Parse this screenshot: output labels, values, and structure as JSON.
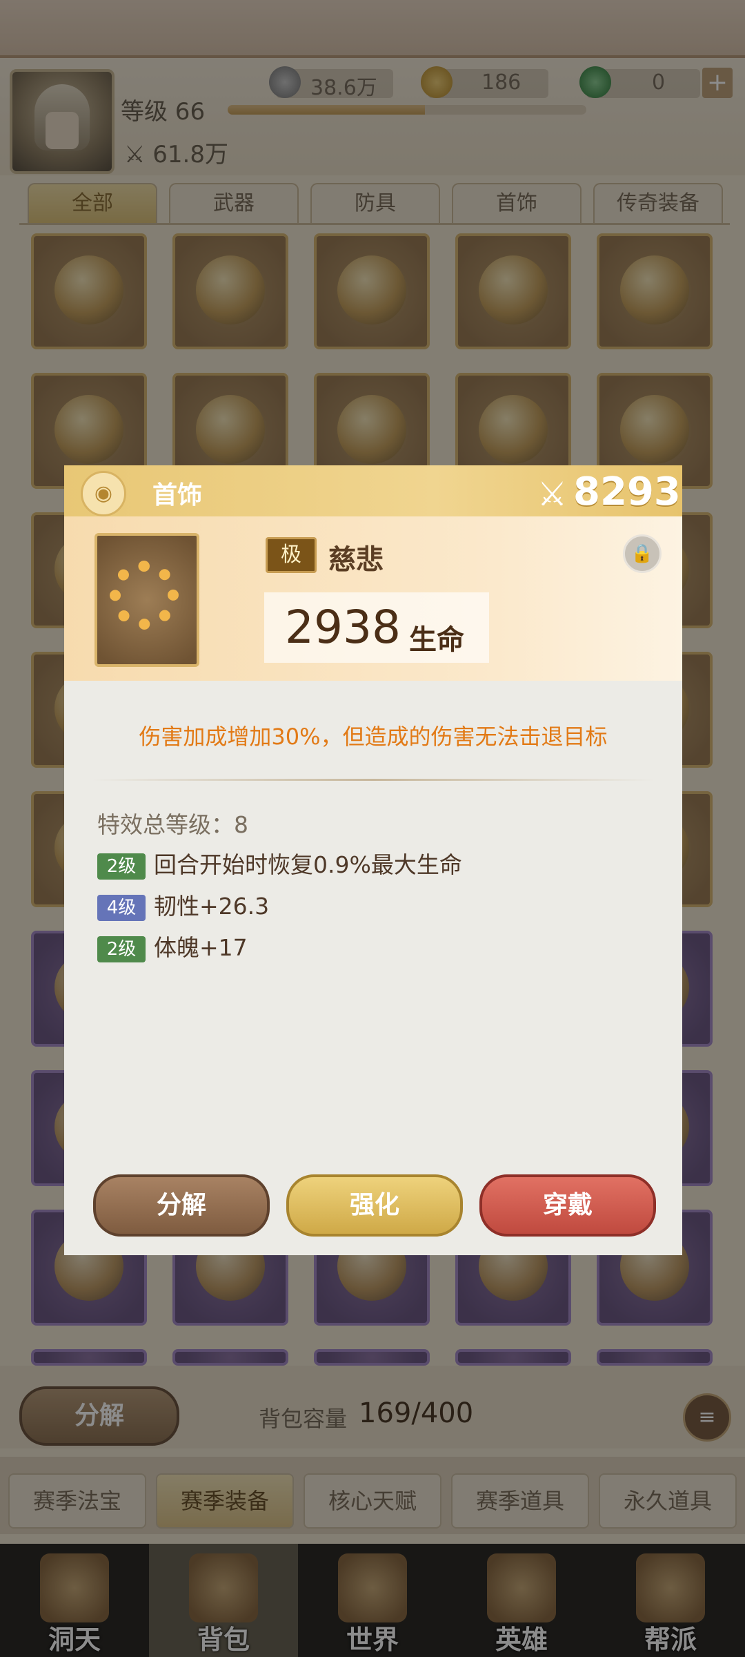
{
  "header": {
    "level_label": "等级 66",
    "level_progress": 0.55,
    "power": "61.8万",
    "resources": [
      {
        "icon": "silver-ingot-icon",
        "value": "38.6万"
      },
      {
        "icon": "gold-ingot-icon",
        "value": "186"
      },
      {
        "icon": "jade-toad-icon",
        "value": "0"
      }
    ],
    "plus": "+"
  },
  "category_tabs": [
    "全部",
    "武器",
    "防具",
    "首饰",
    "传奇装备"
  ],
  "dialog": {
    "category": "首饰",
    "power_icon": "⚔",
    "power": "8293",
    "grade": "极",
    "item_name": "慈悲",
    "stat_value": "2938",
    "stat_label": "生命",
    "description": "伤害加成增加30%，但造成的伤害无法击退目标",
    "effects_total_label": "特效总等级：8",
    "effects": [
      {
        "level": "2级",
        "color": "green",
        "text": "回合开始时恢复0.9%最大生命"
      },
      {
        "level": "4级",
        "color": "blue",
        "text": "韧性+26.3"
      },
      {
        "level": "2级",
        "color": "green",
        "text": "体魄+17"
      }
    ],
    "buttons": {
      "decompose": "分解",
      "strengthen": "强化",
      "wear": "穿戴"
    }
  },
  "bottom": {
    "decompose": "分解",
    "capacity_label": "背包容量",
    "capacity_value": "169/400"
  },
  "sub_tabs": [
    "赛季法宝",
    "赛季装备",
    "核心天赋",
    "赛季道具",
    "永久道具"
  ],
  "nav": [
    "洞天",
    "背包",
    "世界",
    "英雄",
    "帮派"
  ]
}
